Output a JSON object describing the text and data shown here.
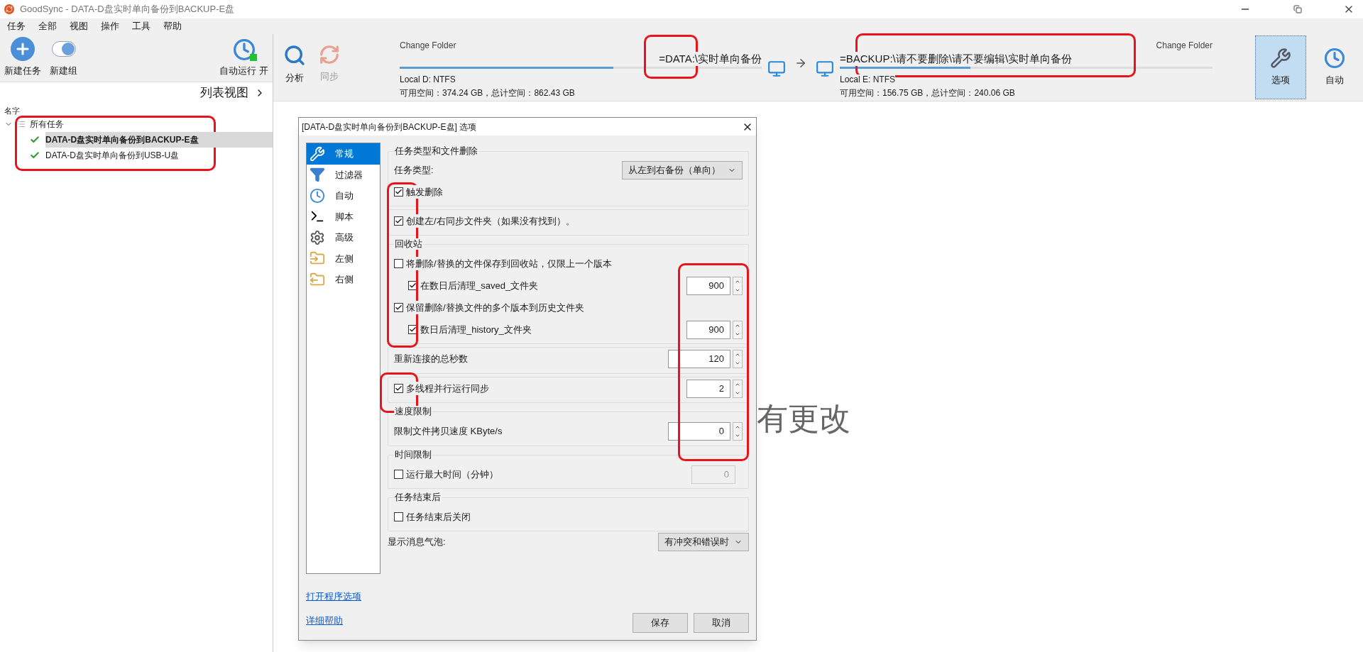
{
  "window": {
    "title": "GoodSync - DATA-D盘实时单向备份到BACKUP-E盘"
  },
  "menu": [
    "任务",
    "全部",
    "视图",
    "操作",
    "工具",
    "帮助"
  ],
  "toolbar": {
    "left_buttons": [
      {
        "kind": "add",
        "label": "新建任务"
      },
      {
        "kind": "group",
        "label": "新建组"
      }
    ],
    "auto_run": {
      "label": "自动运行 开",
      "on": true
    },
    "actions": [
      {
        "kind": "analyze",
        "label": "分析",
        "disabled": false
      },
      {
        "kind": "sync",
        "label": "同步",
        "disabled": true
      }
    ],
    "right_buttons": [
      {
        "kind": "options",
        "label": "选项",
        "selected": true
      },
      {
        "kind": "auto",
        "label": "自动",
        "selected": false
      }
    ]
  },
  "folders": {
    "left": {
      "heading": "Change Folder",
      "path": "=DATA:\\实时单向备份",
      "level": 0.59,
      "drive": "Local D: NTFS",
      "space": "可用空间：374.24 GB，总计空间：862.43 GB"
    },
    "right": {
      "heading": "Change Folder",
      "path": "=BACKUP:\\请不要删除\\请不要编辑\\实时单向备份",
      "level": 0.35,
      "drive": "Local E: NTFS",
      "space": "可用空间：156.75 GB，总计空间：240.06 GB"
    }
  },
  "left_pane": {
    "view_label": "列表视图",
    "column": "名字",
    "tree": [
      {
        "label": "所有任务",
        "expanded": true,
        "children": [
          {
            "label": "DATA-D盘实时单向备份到BACKUP-E盘",
            "selected": true,
            "ok": true
          },
          {
            "label": "DATA-D盘实时单向备份到USB-U盘",
            "selected": false,
            "ok": true
          }
        ]
      }
    ]
  },
  "main_message": "有更改",
  "dialog": {
    "title": "[DATA-D盘实时单向备份到BACKUP-E盘] 选项",
    "nav": [
      {
        "kind": "general",
        "label": "常规",
        "selected": true
      },
      {
        "kind": "filter",
        "label": "过滤器",
        "selected": false
      },
      {
        "kind": "auto",
        "label": "自动",
        "selected": false
      },
      {
        "kind": "script",
        "label": "脚本",
        "selected": false
      },
      {
        "kind": "advanced",
        "label": "高级",
        "selected": false
      },
      {
        "kind": "left",
        "label": "左侧",
        "selected": false
      },
      {
        "kind": "right",
        "label": "右侧",
        "selected": false
      }
    ],
    "groups": [
      {
        "title": "任务类型和文件删除",
        "items": [
          {
            "kind": "select",
            "label": "任务类型:",
            "value": "从左到右备份（单向）"
          },
          {
            "kind": "checkbox",
            "label": "触发删除",
            "checked": true
          }
        ]
      },
      {
        "items": [
          {
            "kind": "checkbox",
            "label": "创建左/右同步文件夹（如果没有找到）。",
            "checked": true
          }
        ]
      },
      {
        "title": "回收站",
        "items": [
          {
            "kind": "checkbox",
            "label": "将删除/替换的文件保存到回收站，仅限上一个版本",
            "checked": false,
            "children": [
              {
                "kind": "checkbox",
                "label": "在数日后清理_saved_文件夹",
                "checked": true,
                "value": "900"
              }
            ]
          },
          {
            "kind": "checkbox",
            "label": "保留删除/替换文件的多个版本到历史文件夹",
            "checked": true,
            "children": [
              {
                "kind": "checkbox",
                "label": "数日后清理_history_文件夹",
                "checked": true,
                "value": "900"
              }
            ]
          }
        ]
      },
      {
        "items": [
          {
            "kind": "spin",
            "label": "重新连接的总秒数",
            "value": "120"
          }
        ]
      },
      {
        "items": [
          {
            "kind": "checkbox",
            "label": "多线程并行运行同步",
            "checked": true,
            "value": "2"
          }
        ]
      },
      {
        "title": "速度限制",
        "items": [
          {
            "kind": "spin",
            "label": "限制文件拷贝速度 KByte/s",
            "value": "0"
          }
        ]
      },
      {
        "title": "时间限制",
        "items": [
          {
            "kind": "checkbox",
            "label": "运行最大时间（分钟）",
            "checked": false,
            "value": "0",
            "value_disabled": true
          }
        ]
      },
      {
        "title": "任务结束后",
        "items": [
          {
            "kind": "checkbox",
            "label": "任务结束后关闭",
            "checked": false
          }
        ]
      }
    ],
    "bubble": {
      "label": "显示消息气泡:",
      "value": "有冲突和错误时"
    },
    "links": [
      "打开程序选项",
      "详细帮助"
    ],
    "buttons": [
      "保存",
      "取消"
    ]
  }
}
